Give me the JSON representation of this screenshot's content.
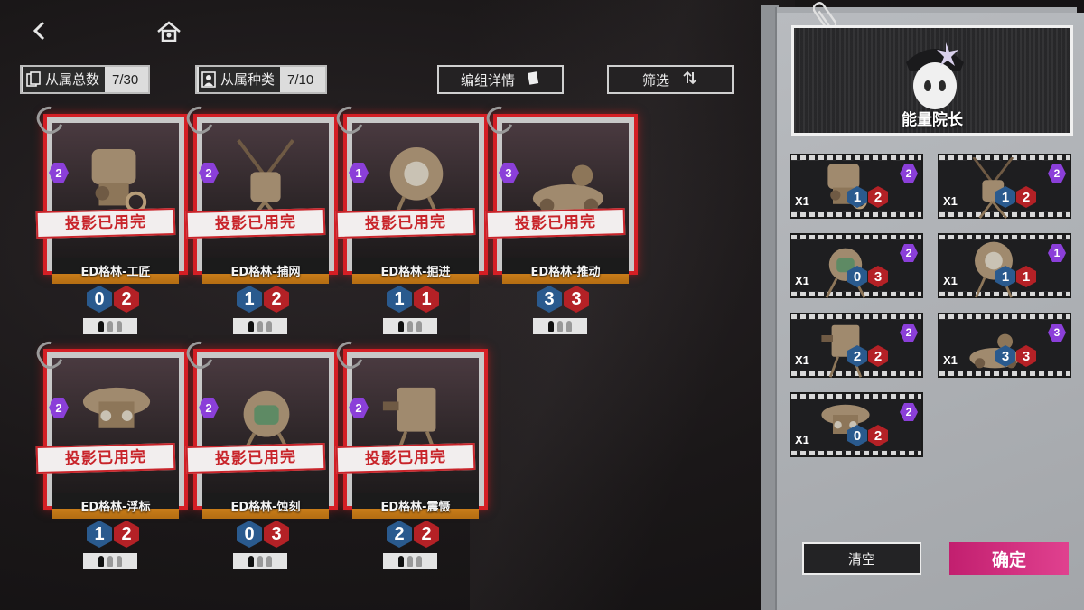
{
  "colors": {
    "card_border": "#d41f25",
    "level_purple": "#8b3fd9",
    "cost_blue": "#2a5a8e",
    "cost_red": "#b42126",
    "confirm_pink": "#d8307f"
  },
  "topbar": {
    "back_icon": "back-arrow-icon",
    "home_icon": "home-icon",
    "total": {
      "label": "从属总数",
      "value": "7/30"
    },
    "kinds": {
      "label": "从属种类",
      "value": "7/10"
    },
    "group_details_label": "编组详情",
    "filter_label": "筛选"
  },
  "cards": [
    {
      "level": "2",
      "stamp": "投影已用完",
      "name": "ED格林-工匠",
      "cost_blue": "0",
      "cost_red": "2"
    },
    {
      "level": "2",
      "stamp": "投影已用完",
      "name": "ED格林-捕网",
      "cost_blue": "1",
      "cost_red": "2"
    },
    {
      "level": "1",
      "stamp": "投影已用完",
      "name": "ED格林-掘进",
      "cost_blue": "1",
      "cost_red": "1"
    },
    {
      "level": "3",
      "stamp": "投影已用完",
      "name": "ED格林-推动",
      "cost_blue": "3",
      "cost_red": "3"
    },
    {
      "level": "2",
      "stamp": "投影已用完",
      "name": "ED格林-浮标",
      "cost_blue": "1",
      "cost_red": "2"
    },
    {
      "level": "2",
      "stamp": "投影已用完",
      "name": "ED格林-蚀刻",
      "cost_blue": "0",
      "cost_red": "3"
    },
    {
      "level": "2",
      "stamp": "投影已用完",
      "name": "ED格林-震慑",
      "cost_blue": "2",
      "cost_red": "2"
    }
  ],
  "panel": {
    "leader_name": "能量院长",
    "units": [
      {
        "count": "X1",
        "level": "2",
        "cost_blue": "1",
        "cost_red": "2"
      },
      {
        "count": "X1",
        "level": "2",
        "cost_blue": "1",
        "cost_red": "2"
      },
      {
        "count": "X1",
        "level": "2",
        "cost_blue": "0",
        "cost_red": "3"
      },
      {
        "count": "X1",
        "level": "1",
        "cost_blue": "1",
        "cost_red": "1"
      },
      {
        "count": "X1",
        "level": "2",
        "cost_blue": "2",
        "cost_red": "2"
      },
      {
        "count": "X1",
        "level": "3",
        "cost_blue": "3",
        "cost_red": "3"
      },
      {
        "count": "X1",
        "level": "2",
        "cost_blue": "0",
        "cost_red": "2"
      }
    ],
    "clear_label": "清空",
    "confirm_label": "确定"
  }
}
